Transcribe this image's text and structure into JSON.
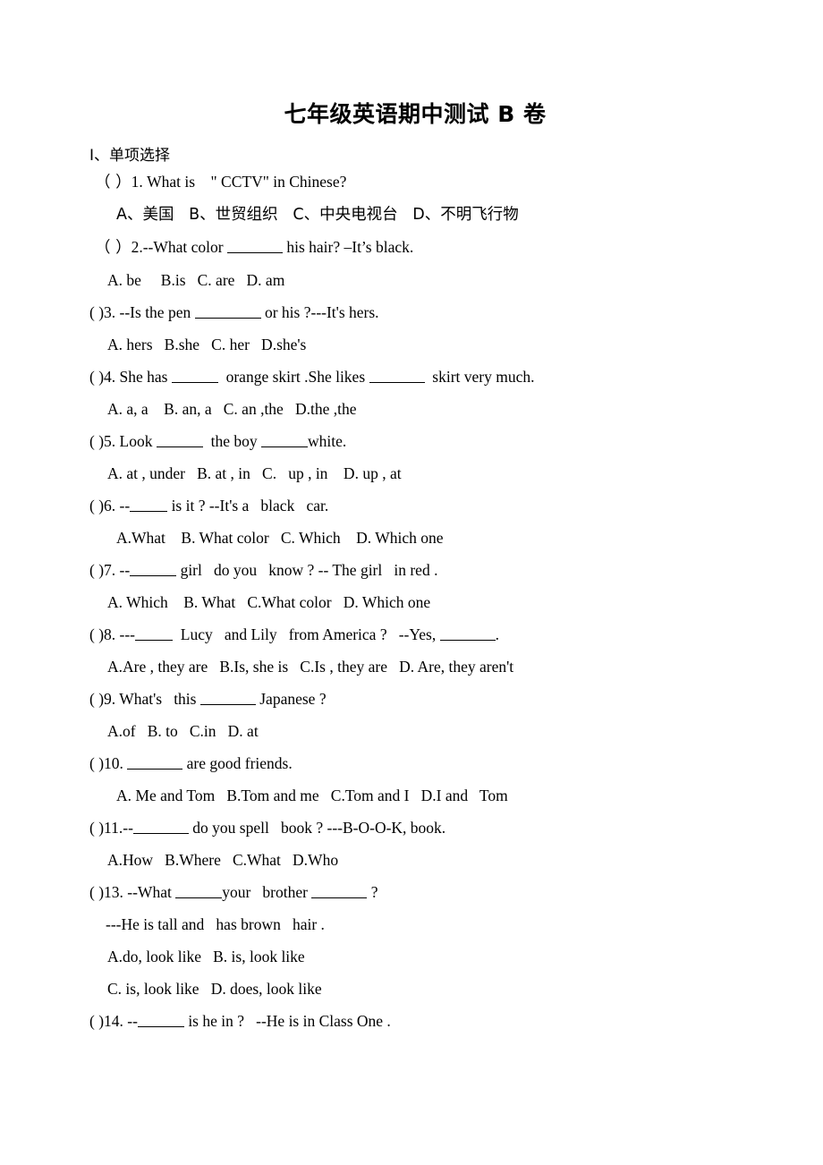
{
  "document": {
    "title": "七年级英语期中测试 B 卷",
    "section_heading": "Ⅰ、单项选择"
  },
  "questions": [
    {
      "id": "q1",
      "marker": "（ ）",
      "number": "1.",
      "stem_before": " What is    \" CCTV\" in Chinese?",
      "options_line": "A、美国   B、世贸组织   C、中央电视台   D、不明飞行物"
    },
    {
      "id": "q2",
      "marker": "（ ）",
      "number": "2.",
      "stem_before": "--What color ",
      "stem_after": " his hair? –It’s black.",
      "options_line": "A. be     B.is   C. are   D. am"
    },
    {
      "id": "q3",
      "marker": "( )",
      "number": "3.",
      "stem_before": " --Is the pen ",
      "stem_after": " or his ?---It's hers.",
      "options_line": "A. hers   B.she   C. her   D.she's"
    },
    {
      "id": "q4",
      "marker": "( )",
      "number": "4.",
      "stem_before": " She has ",
      "stem_mid": "  orange skirt .She likes ",
      "stem_after": "  skirt very much.",
      "options_line": "A. a, a    B. an, a   C. an ,the   D.the ,the"
    },
    {
      "id": "q5",
      "marker": "( )",
      "number": "5.",
      "stem_before": " Look ",
      "stem_mid": "  the boy ",
      "stem_after": "white.",
      "options_line": "A. at , under   B. at , in   C.   up , in    D. up , at"
    },
    {
      "id": "q6",
      "marker": "( )",
      "number": "6.",
      "stem_before": " --",
      "stem_after": " is it ? --It's a   black   car.",
      "options_line": "A.What    B. What color   C. Which    D. Which one"
    },
    {
      "id": "q7",
      "marker": "( )",
      "number": "7.",
      "stem_before": " --",
      "stem_after": " girl   do you   know ? -- The girl   in red .",
      "options_line": "A. Which    B. What   C.What color   D. Which one"
    },
    {
      "id": "q8",
      "marker": "( )",
      "number": "8.",
      "stem_before": " ---",
      "stem_mid": "  Lucy   and Lily   from America ?   --Yes, ",
      "stem_after": ".",
      "options_line": "A.Are , they are   B.Is, she is   C.Is , they are   D. Are, they aren't"
    },
    {
      "id": "q9",
      "marker": "( )",
      "number": "9.",
      "stem_before": " What's   this ",
      "stem_after": " Japanese ?",
      "options_line": "A.of   B. to   C.in   D. at"
    },
    {
      "id": "q10",
      "marker": "( )",
      "number": "10.",
      "stem_before": " ",
      "stem_after": " are good friends.",
      "options_line": "A. Me and Tom   B.Tom and me   C.Tom and I   D.I and   Tom"
    },
    {
      "id": "q11",
      "marker": "( )",
      "number": "11.",
      "stem_before": "--",
      "stem_after": " do you spell   book ? ---B-O-O-K, book.",
      "options_line": "A.How   B.Where   C.What   D.Who"
    },
    {
      "id": "q13",
      "marker": "( )",
      "number": "13.",
      "stem_before": " --What ",
      "stem_mid": "your   brother ",
      "stem_after": " ?",
      "continuation": "---He is tall and   has brown   hair .",
      "options_line_1": "A.do, look like   B. is, look like",
      "options_line_2": "C. is, look like   D. does, look like"
    },
    {
      "id": "q14",
      "marker": "( )",
      "number": "14.",
      "stem_before": " --",
      "stem_after": " is he in ?   --He is in Class One ."
    }
  ]
}
